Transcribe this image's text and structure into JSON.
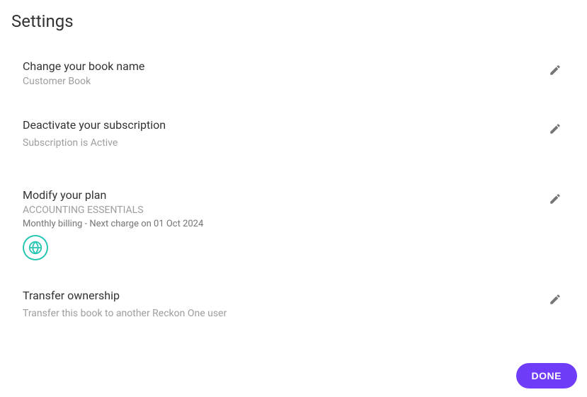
{
  "page": {
    "title": "Settings"
  },
  "items": {
    "bookName": {
      "title": "Change your book name",
      "value": "Customer Book"
    },
    "subscription": {
      "title": "Deactivate your subscription",
      "status": "Subscription is Active"
    },
    "plan": {
      "title": "Modify your plan",
      "name": "ACCOUNTING ESSENTIALS",
      "billing": "Monthly billing - Next charge on 01 Oct 2024"
    },
    "transfer": {
      "title": "Transfer ownership",
      "description": "Transfer this book to another Reckon One user"
    }
  },
  "buttons": {
    "done": "DONE"
  }
}
